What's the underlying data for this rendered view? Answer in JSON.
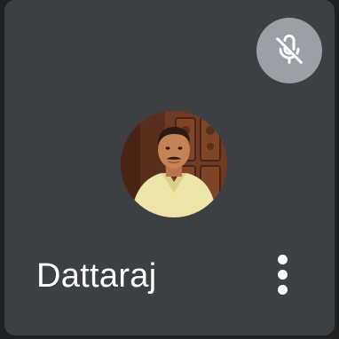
{
  "participant": {
    "name": "Dattaraj",
    "avatar_icon": "user-photo-avatar",
    "mic_status_icon": "mic-off-icon",
    "more_options_icon": "more-vert-icon"
  },
  "colors": {
    "tile_background": "#3c4043",
    "mute_badge_background": "#9aa0a6",
    "text": "#ffffff"
  }
}
